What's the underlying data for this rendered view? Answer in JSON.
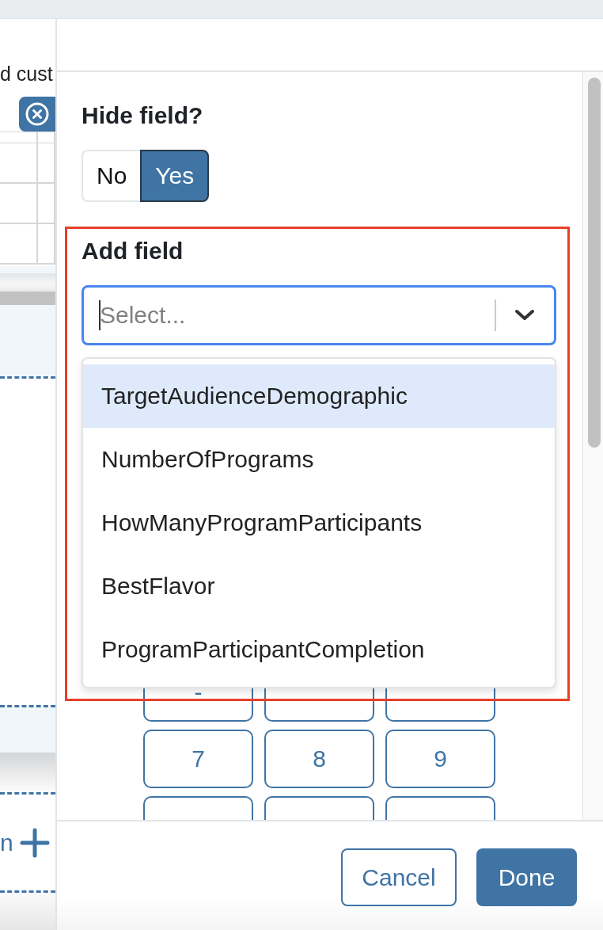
{
  "background_page": {
    "heading_fragment": "d cust",
    "add_link_fragment": "n"
  },
  "panel": {
    "hide_field": {
      "label": "Hide field?",
      "options": [
        {
          "label": "No",
          "selected": false
        },
        {
          "label": "Yes",
          "selected": true
        }
      ]
    },
    "add_field": {
      "label": "Add field",
      "select": {
        "placeholder": "Select...",
        "expanded": true
      },
      "options": [
        {
          "label": "TargetAudienceDemographic",
          "selected": true
        },
        {
          "label": "NumberOfPrograms",
          "selected": false
        },
        {
          "label": "HowManyProgramParticipants",
          "selected": false
        },
        {
          "label": "BestFlavor",
          "selected": false
        },
        {
          "label": "ProgramParticipantCompletion",
          "selected": false
        }
      ]
    },
    "keypad": {
      "rows": [
        {
          "keys": [
            "-"
          ]
        },
        {
          "keys": [
            "7",
            "8",
            "9"
          ]
        }
      ]
    },
    "footer": {
      "buttons": [
        {
          "label": "Cancel",
          "kind": "secondary"
        },
        {
          "label": "Done",
          "kind": "primary"
        }
      ]
    }
  }
}
